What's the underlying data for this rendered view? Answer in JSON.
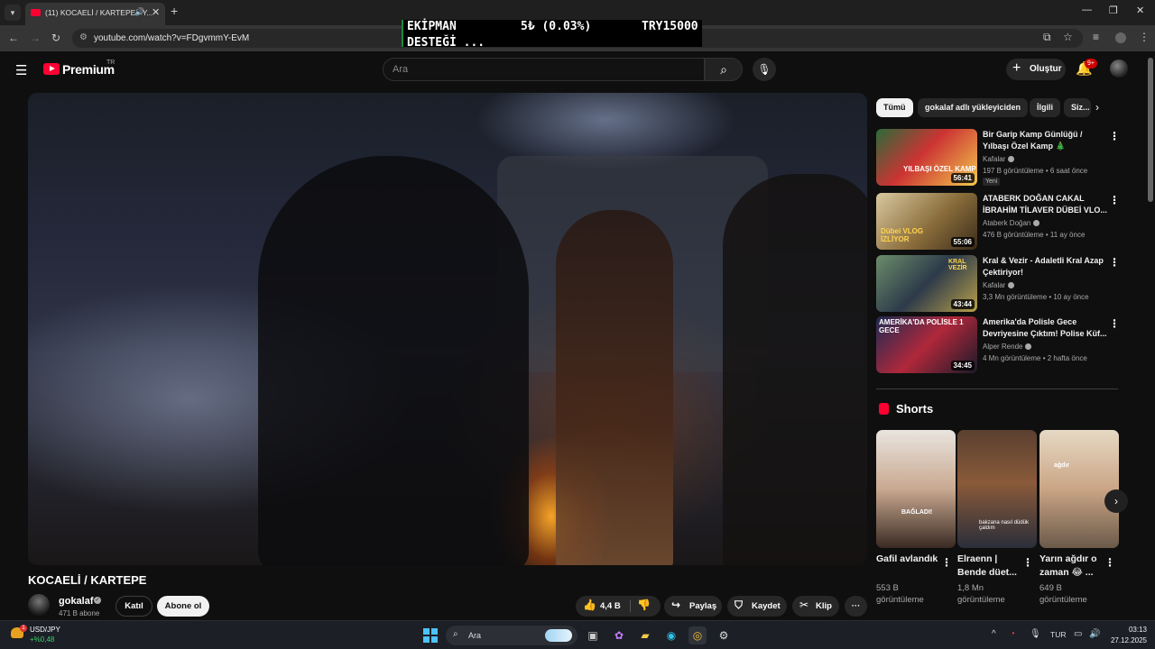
{
  "browser": {
    "tab_title": "(11) KOCAELİ / KARTEPE - Y...",
    "tab_audio_icon": "speaker-icon",
    "url": "youtube.com/watch?v=FDgvmmY-EvM",
    "win_minimize": "—",
    "win_restore": "❐",
    "win_close": "✕"
  },
  "ticker": {
    "label_line1": "EKİPMAN",
    "label_line2": "DESTEĞİ ...",
    "amount": "5₺ (0.03%)",
    "goal": "TRY15000"
  },
  "header": {
    "logo_text": "Premium",
    "logo_region": "TR",
    "search_placeholder": "Ara",
    "create_label": "Oluştur",
    "notif_count": "9+"
  },
  "video": {
    "title": "KOCAELİ / KARTEPE",
    "channel": "gokalaf",
    "subscribers": "471 B abone",
    "join_label": "Katıl",
    "subscribe_label": "Abone ol",
    "likes": "4,4 B",
    "share_label": "Paylaş",
    "save_label": "Kaydet",
    "clip_label": "Klip",
    "more_label": "···"
  },
  "sidebar": {
    "chips": [
      "Tümü",
      "gokalaf adlı yükleyiciden",
      "İlgili",
      "Siz..."
    ],
    "recommendations": [
      {
        "title": "Bir Garip Kamp Günlüğü / Yılbaşı Özel Kamp 🎄",
        "channel": "Kafalar",
        "meta": "197 B görüntüleme • 6 saat önce",
        "badge": "Yeni",
        "duration": "56:41",
        "thumb_text": "YILBAŞI ÖZEL KAMP"
      },
      {
        "title": "ATABERK DOĞAN CAKAL İBRAHİM TİLAVER DÜBEİ VLO...",
        "channel": "Ataberk Doğan",
        "meta": "476 B görüntüleme • 11 ay önce",
        "badge": "",
        "duration": "55:06",
        "thumb_text": "Dübei VLOG İZLİYOR"
      },
      {
        "title": "Kral & Vezir - Adaletli Kral Azap Çektiriyor!",
        "channel": "Kafalar",
        "meta": "3,3 Mn görüntüleme • 10 ay önce",
        "badge": "",
        "duration": "43:44",
        "thumb_text": "KRAL VEZİR"
      },
      {
        "title": "Amerika'da Polisle Gece Devriyesine Çıktım! Polise Küf...",
        "channel": "Alper Rende",
        "meta": "4 Mn görüntüleme • 2 hafta önce",
        "badge": "",
        "duration": "34:45",
        "thumb_text": "AMERİKA'DA POLİSLE 1 GECE"
      }
    ],
    "shorts_title": "Shorts",
    "shorts": [
      {
        "title": "Gafil avlandık",
        "views": "553 B görüntüleme",
        "overlay": "BAĞLADI!"
      },
      {
        "title": "Elraenn | Bende düet...",
        "views": "1,8 Mn görüntüleme",
        "overlay": "bakzana nasıl düdük çaldım"
      },
      {
        "title": "Yarın ağdır o zaman 😂 ...",
        "views": "649 B görüntüleme",
        "overlay": "ağdır"
      }
    ]
  },
  "taskbar": {
    "widget_badge": "1",
    "widget_line1": "USD/JPY",
    "widget_line2": "+%0,48",
    "search_placeholder": "Ara",
    "language": "TUR",
    "time": "03:13",
    "date": "27.12.2025"
  }
}
